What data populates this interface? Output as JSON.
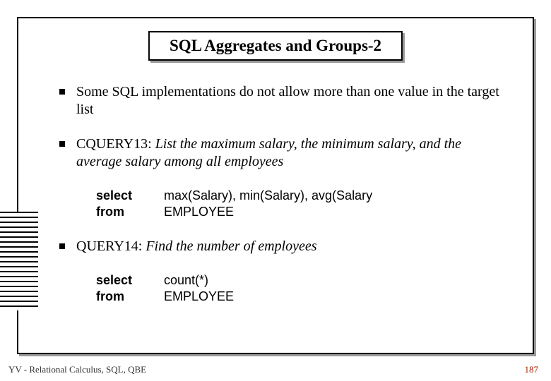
{
  "title": "SQL Aggregates and Groups-2",
  "bullets": [
    {
      "text": "Some SQL implementations do not allow more than one value in the target list"
    },
    {
      "prefix": "CQUERY13: ",
      "italic": "List the maximum salary, the minimum salary, and the average salary among all employees"
    },
    {
      "prefix": "QUERY14: ",
      "italic": "Find the number of employees"
    }
  ],
  "code1": {
    "select_kw": "select",
    "select_val": "max(Salary), min(Salary), avg(Salary",
    "from_kw": "from",
    "from_val": "EMPLOYEE"
  },
  "code2": {
    "select_kw": "select",
    "select_val": "count(*)",
    "from_kw": "from",
    "from_val": "EMPLOYEE"
  },
  "footer_left": "YV  -  Relational Calculus, SQL, QBE",
  "footer_right": "187"
}
